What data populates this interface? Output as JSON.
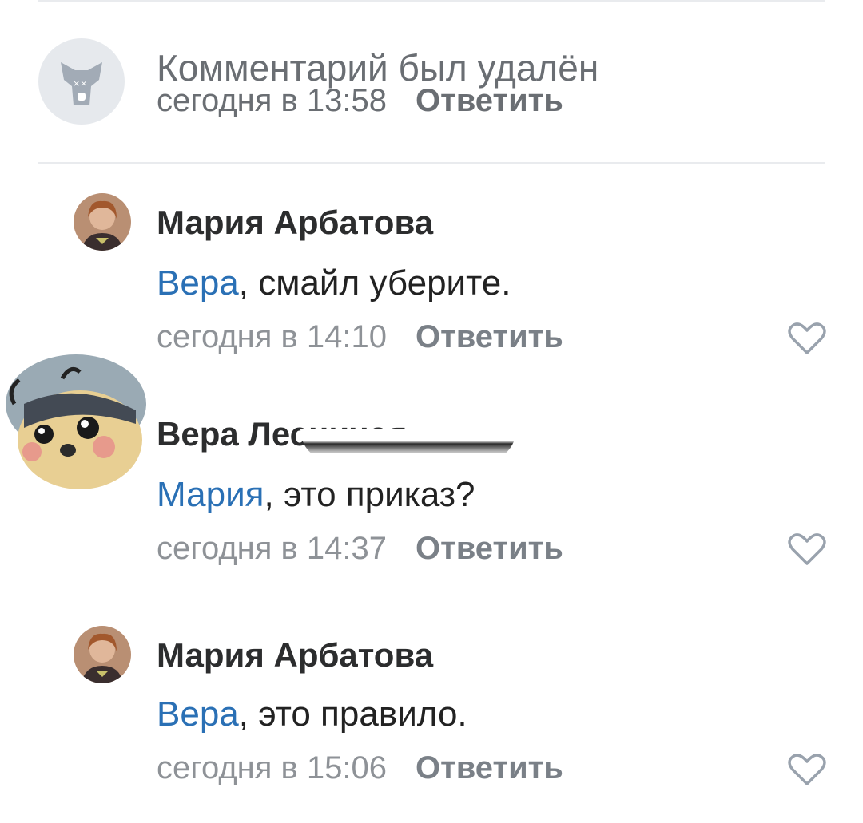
{
  "deleted": {
    "text": "Комментарий был удалён",
    "time": "сегодня в 13:58",
    "reply": "Ответить"
  },
  "comments": [
    {
      "author": "Мария Арбатова",
      "mention": "Вера",
      "rest": ", смайл уберите.",
      "time": "сегодня в 14:10",
      "reply": "Ответить"
    },
    {
      "author": "Вера Лесничая",
      "mention": "Мария",
      "rest": ", это приказ?",
      "time": "сегодня в 14:37",
      "reply": "Ответить"
    },
    {
      "author": "Мария Арбатова",
      "mention": "Вера",
      "rest": ", это правило.",
      "time": "сегодня в 15:06",
      "reply": "Ответить"
    }
  ],
  "colors": {
    "mention": "#2a70b5",
    "meta": "#8e9297",
    "divider": "#e9ebee"
  },
  "icons": {
    "deleted_avatar": "vk-dog-deleted-icon",
    "like": "heart-outline-icon"
  }
}
